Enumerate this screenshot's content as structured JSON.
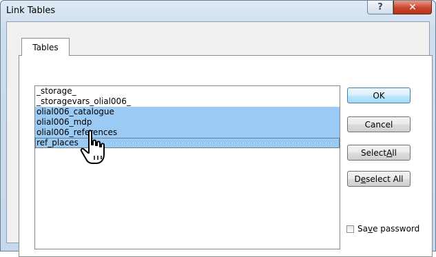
{
  "window": {
    "title": "Link Tables",
    "help_label": "?",
    "close_label": "✕"
  },
  "tab": {
    "label": "Tables"
  },
  "list": {
    "items": [
      {
        "label": "_storage_",
        "selected": false
      },
      {
        "label": "_storagevars_olial006_",
        "selected": false
      },
      {
        "label": "olial006_catalogue",
        "selected": true
      },
      {
        "label": "olial006_mdp",
        "selected": true
      },
      {
        "label": "olial006_references",
        "selected": true
      },
      {
        "label": "ref_places",
        "selected": true,
        "focused": true
      }
    ]
  },
  "buttons": {
    "ok": "OK",
    "cancel": "Cancel",
    "select_all": {
      "before": "Select ",
      "accel": "A",
      "after": "ll"
    },
    "deselect_all": {
      "before": "D",
      "accel": "e",
      "after": "select All"
    }
  },
  "save_password": {
    "before": "Sa",
    "accel": "v",
    "after": "e password",
    "checked": false
  },
  "cursor": {
    "icon": "hand-pointer-icon"
  }
}
